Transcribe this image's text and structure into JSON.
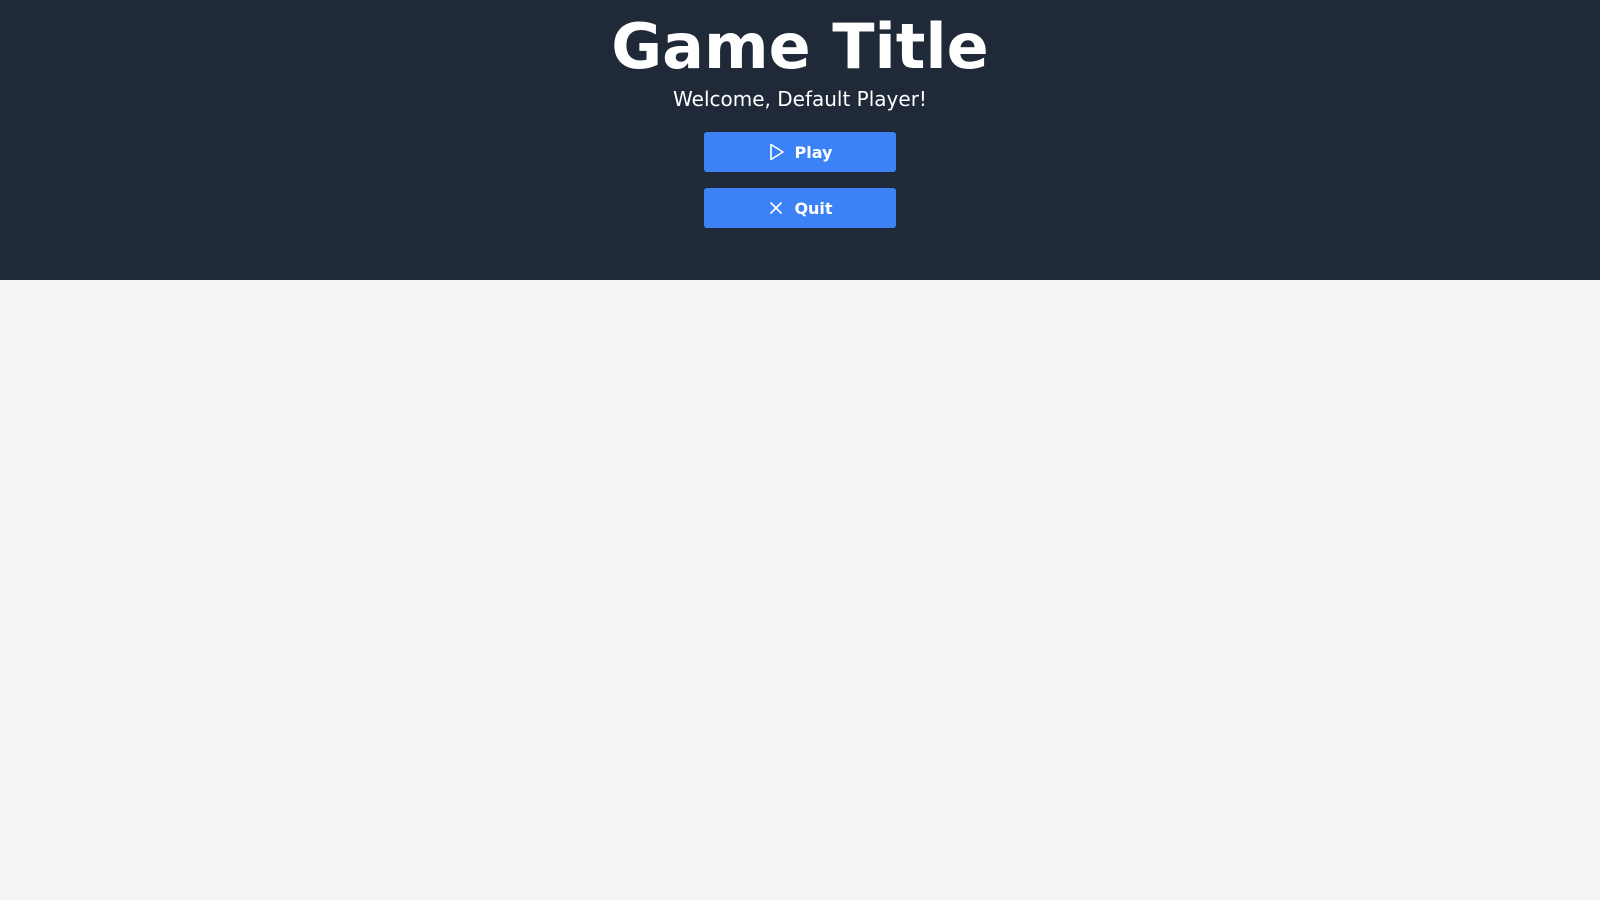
{
  "header": {
    "title": "Game Title",
    "welcome": "Welcome, Default Player!"
  },
  "menu": {
    "play_label": "Play",
    "play_icon": "play-icon",
    "quit_label": "Quit",
    "quit_icon": "close-icon"
  },
  "colors": {
    "header_bg": "#1f2937",
    "page_bg": "#f3f4f6",
    "button_bg": "#3b82f6",
    "text": "#ffffff"
  }
}
